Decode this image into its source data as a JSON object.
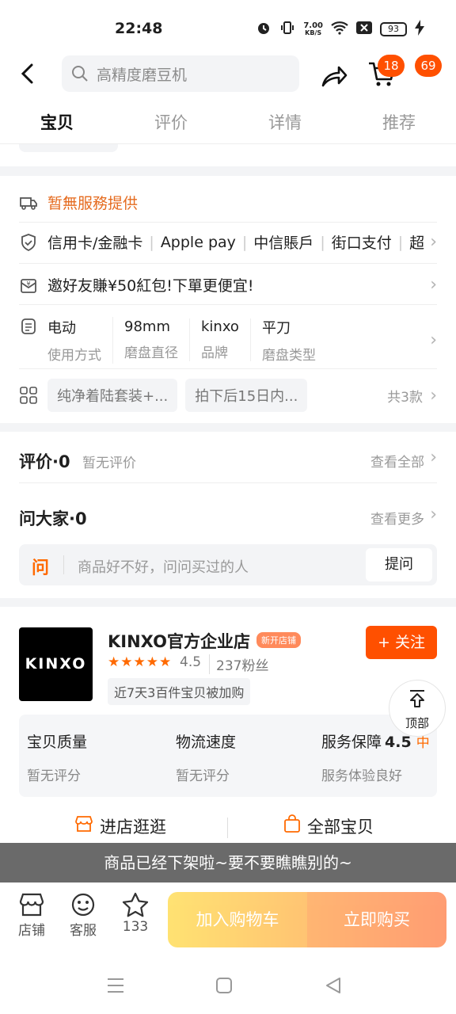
{
  "status_bar": {
    "time": "22:48",
    "net_speed_value": "7.00",
    "net_speed_unit": "KB/S",
    "battery": "93"
  },
  "header": {
    "search_placeholder": "高精度磨豆机",
    "cart_badge": "18",
    "message_badge": "69"
  },
  "tabs": [
    {
      "label": "宝贝",
      "active": true
    },
    {
      "label": "评价",
      "active": false
    },
    {
      "label": "详情",
      "active": false
    },
    {
      "label": "推荐",
      "active": false
    }
  ],
  "service": {
    "no_service": "暂無服務提供",
    "payments": [
      "信用卡/金融卡",
      "Apple pay",
      "中信賬戶",
      "街口支付",
      "超"
    ],
    "invite": "邀好友賺¥50紅包!下單更便宜!",
    "specs": [
      {
        "value": "电动",
        "key": "使用方式"
      },
      {
        "value": "98mm",
        "key": "磨盘直径"
      },
      {
        "value": "kinxo",
        "key": "品牌"
      },
      {
        "value": "平刀",
        "key": "磨盘类型"
      }
    ],
    "packages": [
      "纯净着陆套装+...",
      "拍下后15日内..."
    ],
    "package_count": "共3款"
  },
  "reviews": {
    "title": "评价·0",
    "none": "暂无评价",
    "view_all": "查看全部",
    "ask_title": "问大家·0",
    "view_more": "查看更多",
    "ask_icon": "问",
    "ask_placeholder": "商品好不好，问问买过的人",
    "ask_button": "提问"
  },
  "shop": {
    "logo_text": "KINXO",
    "name": "KINXO官方企业店",
    "new_tag": "新开店铺",
    "stars": "★★★★★",
    "rating": "4.5",
    "fans": "237粉丝",
    "hot": "近7天3百件宝贝被加购",
    "follow": "+ 关注",
    "scores": [
      {
        "title": "宝贝质量",
        "sub": "暂无评分"
      },
      {
        "title": "物流速度",
        "sub": "暂无评分"
      },
      {
        "title": "服务保障",
        "num": "4.5",
        "level": "中",
        "sub": "服务体验良好"
      }
    ],
    "enter": "进店逛逛",
    "all_items": "全部宝贝"
  },
  "to_top": "顶部",
  "toast": "商品已经下架啦~要不要瞧瞧别的~",
  "bottom": {
    "store": "店铺",
    "service": "客服",
    "fav_count": "133",
    "add_cart": "加入购物车",
    "buy_now": "立即购买"
  },
  "colors": {
    "accent": "#ff5000",
    "orange_text": "#e56b1f"
  }
}
